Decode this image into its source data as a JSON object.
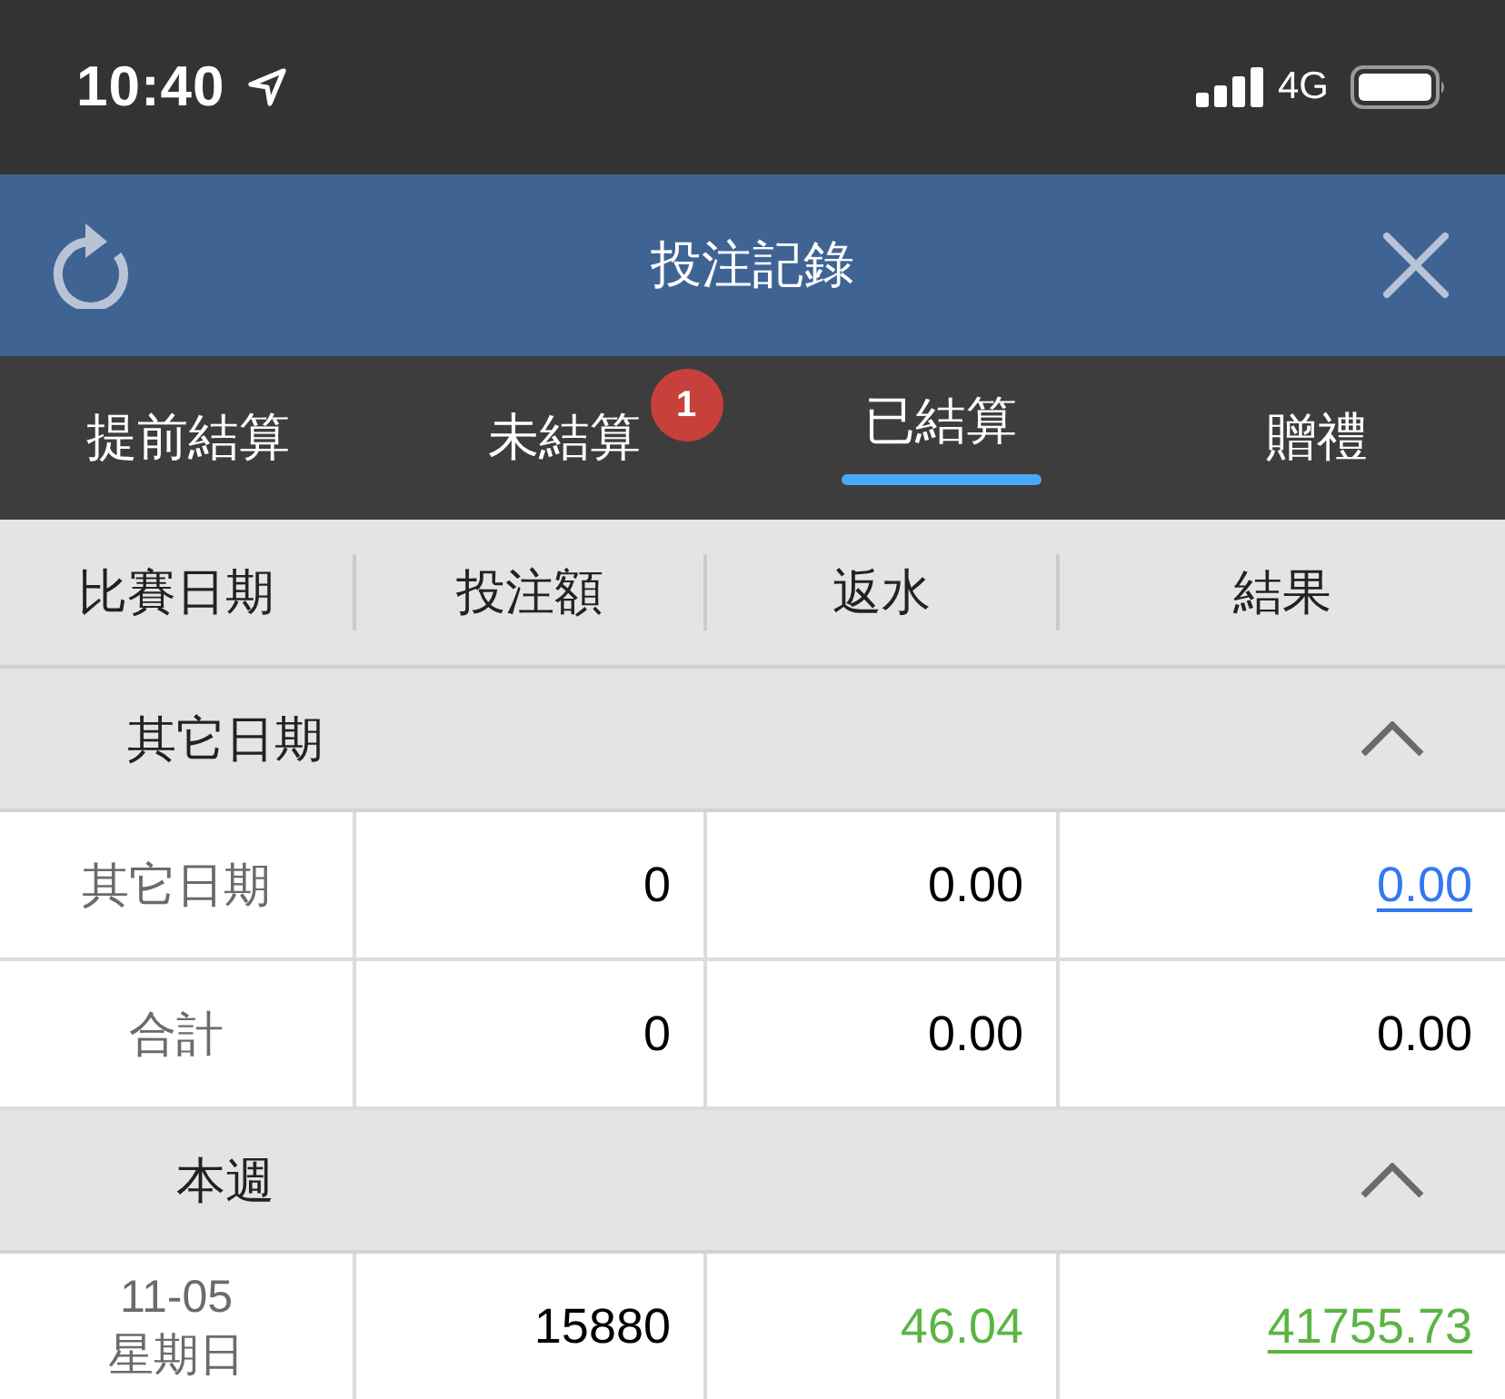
{
  "status_bar": {
    "time": "10:40",
    "network": "4G"
  },
  "header": {
    "title": "投注記錄"
  },
  "tabs": [
    {
      "label": "提前結算",
      "selected": false
    },
    {
      "label": "未結算",
      "selected": false,
      "badge": "1"
    },
    {
      "label": "已結算",
      "selected": true
    },
    {
      "label": "贈禮",
      "selected": false
    }
  ],
  "table": {
    "columns": [
      "比賽日期",
      "投注額",
      "返水",
      "結果"
    ],
    "sections": [
      {
        "title": "其它日期",
        "expanded": true,
        "rows": [
          {
            "date": "其它日期",
            "stake": "0",
            "rebate": {
              "text": "0.00",
              "color": "#000000"
            },
            "result": {
              "text": "0.00",
              "color": "#3478f0",
              "link": true
            }
          },
          {
            "date": "合計",
            "stake": "0",
            "rebate": {
              "text": "0.00",
              "color": "#000000"
            },
            "result": {
              "text": "0.00",
              "color": "#000000",
              "link": false
            }
          }
        ]
      },
      {
        "title": "本週",
        "expanded": true,
        "rows": [
          {
            "date": "11-05",
            "weekday": "星期日",
            "stake": "15880",
            "rebate": {
              "text": "46.04",
              "color": "#5ab543"
            },
            "result": {
              "text": "41755.73",
              "color": "#5ab543",
              "link": true
            }
          }
        ]
      }
    ]
  }
}
